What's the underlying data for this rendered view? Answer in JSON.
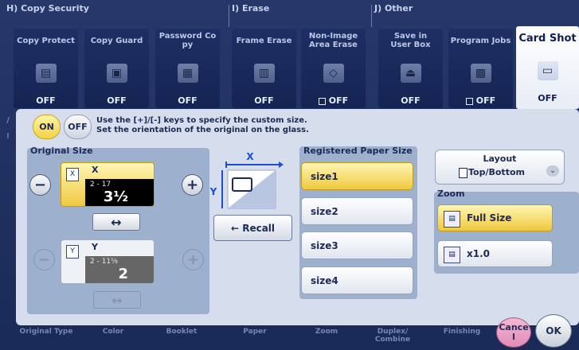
{
  "groups": [
    {
      "label": "H)  Copy Security"
    },
    {
      "label": "I)  Erase"
    },
    {
      "label": "J)  Other"
    }
  ],
  "tabs": [
    {
      "label": "Copy Protect",
      "icon": "copy-protect-icon",
      "value": "OFF",
      "checkbox": false
    },
    {
      "label": "Copy Guard",
      "icon": "copy-guard-icon",
      "value": "OFF",
      "checkbox": false
    },
    {
      "label": "Password Co\npy",
      "icon": "password-copy-icon",
      "value": "OFF",
      "checkbox": false
    },
    {
      "label": "Frame Erase",
      "icon": "frame-erase-icon",
      "value": "OFF",
      "checkbox": false
    },
    {
      "label": "Non-Image\nArea Erase",
      "icon": "non-image-erase-icon",
      "value": "OFF",
      "checkbox": true
    },
    {
      "label": "Save in\nUser Box",
      "icon": "save-user-box-icon",
      "value": "OFF",
      "checkbox": false
    },
    {
      "label": "Program Jobs",
      "icon": "program-jobs-icon",
      "value": "OFF",
      "checkbox": true
    },
    {
      "label": "Card Shot",
      "icon": "card-shot-icon",
      "value": "OFF",
      "checkbox": false
    }
  ],
  "toggle": {
    "on": "ON",
    "off": "OFF"
  },
  "hint": {
    "line1": "Use the [+]/[-] keys to specify the custom size.",
    "line2": "Set the orientation of the original on the glass."
  },
  "original_size": {
    "title": "Original Size",
    "x": {
      "axis": "X",
      "range": "2 - 17",
      "value": "3½"
    },
    "y": {
      "axis": "Y",
      "range": "2 - 11⅝",
      "value": "2"
    },
    "swap_symbol": "↔",
    "minus": "−",
    "plus": "+"
  },
  "diagram": {
    "x_label": "X",
    "y_label": "Y"
  },
  "recall": {
    "label": "← Recall"
  },
  "registered": {
    "title": "Registered Paper Size",
    "sizes": [
      "size1",
      "size2",
      "size3",
      "size4"
    ]
  },
  "layout": {
    "label": "Layout",
    "value": "Top/Bottom",
    "dropdown_symbol": "⌄"
  },
  "zoom": {
    "title": "Zoom",
    "options": [
      "Full Size",
      "x1.0"
    ]
  },
  "bottom_tabs": [
    "Original Type",
    "Color",
    "Booklet",
    "Paper",
    "Zoom",
    "Duplex/\nCombine",
    "Finishing"
  ],
  "cancel": {
    "label": "Cance\nl"
  },
  "ok": {
    "label": "OK"
  }
}
